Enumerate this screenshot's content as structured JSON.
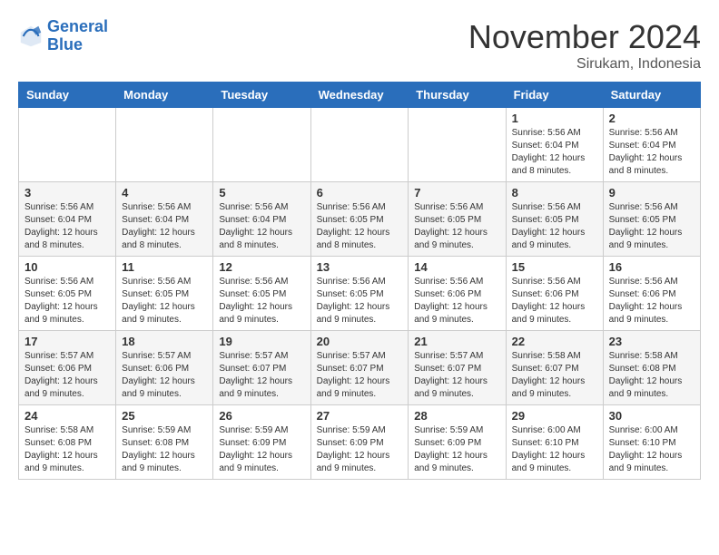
{
  "logo": {
    "line1": "General",
    "line2": "Blue"
  },
  "title": "November 2024",
  "subtitle": "Sirukam, Indonesia",
  "days_of_week": [
    "Sunday",
    "Monday",
    "Tuesday",
    "Wednesday",
    "Thursday",
    "Friday",
    "Saturday"
  ],
  "weeks": [
    [
      {
        "day": "",
        "info": ""
      },
      {
        "day": "",
        "info": ""
      },
      {
        "day": "",
        "info": ""
      },
      {
        "day": "",
        "info": ""
      },
      {
        "day": "",
        "info": ""
      },
      {
        "day": "1",
        "info": "Sunrise: 5:56 AM\nSunset: 6:04 PM\nDaylight: 12 hours and 8 minutes."
      },
      {
        "day": "2",
        "info": "Sunrise: 5:56 AM\nSunset: 6:04 PM\nDaylight: 12 hours and 8 minutes."
      }
    ],
    [
      {
        "day": "3",
        "info": "Sunrise: 5:56 AM\nSunset: 6:04 PM\nDaylight: 12 hours and 8 minutes."
      },
      {
        "day": "4",
        "info": "Sunrise: 5:56 AM\nSunset: 6:04 PM\nDaylight: 12 hours and 8 minutes."
      },
      {
        "day": "5",
        "info": "Sunrise: 5:56 AM\nSunset: 6:04 PM\nDaylight: 12 hours and 8 minutes."
      },
      {
        "day": "6",
        "info": "Sunrise: 5:56 AM\nSunset: 6:05 PM\nDaylight: 12 hours and 8 minutes."
      },
      {
        "day": "7",
        "info": "Sunrise: 5:56 AM\nSunset: 6:05 PM\nDaylight: 12 hours and 9 minutes."
      },
      {
        "day": "8",
        "info": "Sunrise: 5:56 AM\nSunset: 6:05 PM\nDaylight: 12 hours and 9 minutes."
      },
      {
        "day": "9",
        "info": "Sunrise: 5:56 AM\nSunset: 6:05 PM\nDaylight: 12 hours and 9 minutes."
      }
    ],
    [
      {
        "day": "10",
        "info": "Sunrise: 5:56 AM\nSunset: 6:05 PM\nDaylight: 12 hours and 9 minutes."
      },
      {
        "day": "11",
        "info": "Sunrise: 5:56 AM\nSunset: 6:05 PM\nDaylight: 12 hours and 9 minutes."
      },
      {
        "day": "12",
        "info": "Sunrise: 5:56 AM\nSunset: 6:05 PM\nDaylight: 12 hours and 9 minutes."
      },
      {
        "day": "13",
        "info": "Sunrise: 5:56 AM\nSunset: 6:05 PM\nDaylight: 12 hours and 9 minutes."
      },
      {
        "day": "14",
        "info": "Sunrise: 5:56 AM\nSunset: 6:06 PM\nDaylight: 12 hours and 9 minutes."
      },
      {
        "day": "15",
        "info": "Sunrise: 5:56 AM\nSunset: 6:06 PM\nDaylight: 12 hours and 9 minutes."
      },
      {
        "day": "16",
        "info": "Sunrise: 5:56 AM\nSunset: 6:06 PM\nDaylight: 12 hours and 9 minutes."
      }
    ],
    [
      {
        "day": "17",
        "info": "Sunrise: 5:57 AM\nSunset: 6:06 PM\nDaylight: 12 hours and 9 minutes."
      },
      {
        "day": "18",
        "info": "Sunrise: 5:57 AM\nSunset: 6:06 PM\nDaylight: 12 hours and 9 minutes."
      },
      {
        "day": "19",
        "info": "Sunrise: 5:57 AM\nSunset: 6:07 PM\nDaylight: 12 hours and 9 minutes."
      },
      {
        "day": "20",
        "info": "Sunrise: 5:57 AM\nSunset: 6:07 PM\nDaylight: 12 hours and 9 minutes."
      },
      {
        "day": "21",
        "info": "Sunrise: 5:57 AM\nSunset: 6:07 PM\nDaylight: 12 hours and 9 minutes."
      },
      {
        "day": "22",
        "info": "Sunrise: 5:58 AM\nSunset: 6:07 PM\nDaylight: 12 hours and 9 minutes."
      },
      {
        "day": "23",
        "info": "Sunrise: 5:58 AM\nSunset: 6:08 PM\nDaylight: 12 hours and 9 minutes."
      }
    ],
    [
      {
        "day": "24",
        "info": "Sunrise: 5:58 AM\nSunset: 6:08 PM\nDaylight: 12 hours and 9 minutes."
      },
      {
        "day": "25",
        "info": "Sunrise: 5:59 AM\nSunset: 6:08 PM\nDaylight: 12 hours and 9 minutes."
      },
      {
        "day": "26",
        "info": "Sunrise: 5:59 AM\nSunset: 6:09 PM\nDaylight: 12 hours and 9 minutes."
      },
      {
        "day": "27",
        "info": "Sunrise: 5:59 AM\nSunset: 6:09 PM\nDaylight: 12 hours and 9 minutes."
      },
      {
        "day": "28",
        "info": "Sunrise: 5:59 AM\nSunset: 6:09 PM\nDaylight: 12 hours and 9 minutes."
      },
      {
        "day": "29",
        "info": "Sunrise: 6:00 AM\nSunset: 6:10 PM\nDaylight: 12 hours and 9 minutes."
      },
      {
        "day": "30",
        "info": "Sunrise: 6:00 AM\nSunset: 6:10 PM\nDaylight: 12 hours and 9 minutes."
      }
    ]
  ]
}
